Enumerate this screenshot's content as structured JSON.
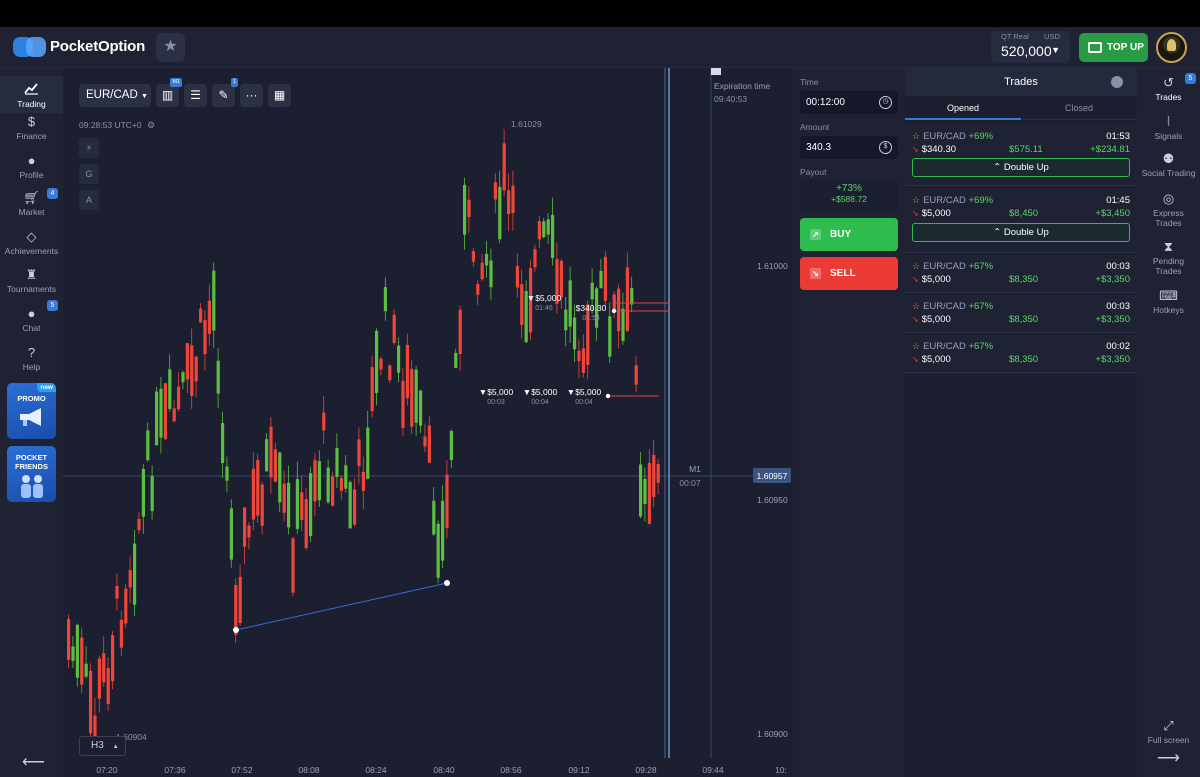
{
  "header": {
    "logo_text": "PocketOption",
    "account_type": "QT Real",
    "currency": "USD",
    "balance": "520,000",
    "topup_label": "TOP UP"
  },
  "left_nav": [
    {
      "label": "Trading",
      "icon": "chart-icon"
    },
    {
      "label": "Finance",
      "icon": "dollar-icon"
    },
    {
      "label": "Profile",
      "icon": "user-icon"
    },
    {
      "label": "Market",
      "icon": "cart-icon",
      "badge": "4"
    },
    {
      "label": "Achievements",
      "icon": "diamond-icon"
    },
    {
      "label": "Tournaments",
      "icon": "trophy-icon"
    },
    {
      "label": "Chat",
      "icon": "chat-icon",
      "badge": "5"
    },
    {
      "label": "Help",
      "icon": "help-icon"
    }
  ],
  "promo": {
    "badge": "new",
    "label": "PROMO"
  },
  "friends": {
    "label1": "POCKET",
    "label2": "FRIENDS"
  },
  "chart": {
    "asset": "EUR/CAD",
    "clock": "09:28:53 UTC+0",
    "timeframe": "H3",
    "tb_badge_1": "M1",
    "tb_badge_2": "1",
    "tools": [
      "G",
      "A"
    ],
    "expiration_label": "Expiration time",
    "expiration_time": "09:40:53",
    "current_price": "1.60957",
    "candle_label": "M1",
    "candle_timer": "00:07",
    "price_levels": [
      "1.61029",
      "1.61000",
      "1.60950",
      "1.60904",
      "1.60900"
    ],
    "time_labels": [
      "07:20",
      "07:36",
      "07:52",
      "08:08",
      "08:24",
      "08:40",
      "08:56",
      "09:12",
      "09:28",
      "09:44",
      "10:"
    ],
    "trade_marks": [
      {
        "amount": "▼$5,000",
        "time": "01:46"
      },
      {
        "amount": "$340.30",
        "time": "01:54"
      },
      {
        "amount": "▼$5,000",
        "time": "00:03"
      },
      {
        "amount": "▼$5,000",
        "time": "00:04"
      },
      {
        "amount": "▼$5,000",
        "time": "00:04"
      }
    ]
  },
  "trade_panel": {
    "time_label": "Time",
    "time_value": "00:12:00",
    "amount_label": "Amount",
    "amount_value": "340.3",
    "payout_label": "Payout",
    "payout_pct": "+73%",
    "payout_value": "+$588.72",
    "buy_label": "BUY",
    "sell_label": "SELL"
  },
  "trades_panel": {
    "title": "Trades",
    "tabs": [
      "Opened",
      "Closed"
    ],
    "double_up_label": "Double Up",
    "items": [
      {
        "asset": "EUR/CAD",
        "pct": "+69%",
        "time": "01:53",
        "amount": "$340.30",
        "payout": "$575.11",
        "profit": "+$234.81"
      },
      {
        "asset": "EUR/CAD",
        "pct": "+69%",
        "time": "01:45",
        "amount": "$5,000",
        "payout": "$8,450",
        "profit": "+$3,450"
      },
      {
        "asset": "EUR/CAD",
        "pct": "+67%",
        "time": "00:03",
        "amount": "$5,000",
        "payout": "$8,350",
        "profit": "+$3,350"
      },
      {
        "asset": "EUR/CAD",
        "pct": "+67%",
        "time": "00:03",
        "amount": "$5,000",
        "payout": "$8,350",
        "profit": "+$3,350"
      },
      {
        "asset": "EUR/CAD",
        "pct": "+67%",
        "time": "00:02",
        "amount": "$5,000",
        "payout": "$8,350",
        "profit": "+$3,350"
      }
    ]
  },
  "right_nav": [
    {
      "label": "Trades",
      "icon": "history-icon",
      "badge": "5"
    },
    {
      "label": "Signals",
      "icon": "signal-icon"
    },
    {
      "label": "Social Trading",
      "icon": "social-icon"
    },
    {
      "label1": "Express",
      "label2": "Trades",
      "icon": "express-icon"
    },
    {
      "label1": "Pending",
      "label2": "Trades",
      "icon": "hourglass-icon"
    },
    {
      "label": "Hotkeys",
      "icon": "keyboard-icon"
    }
  ],
  "fullscreen_label": "Full screen",
  "colors": {
    "bull": "#5cbf3f",
    "bear": "#f0463a",
    "accent": "#3a7bd5",
    "buy": "#2ebc4f",
    "sell": "#ec3b35"
  }
}
